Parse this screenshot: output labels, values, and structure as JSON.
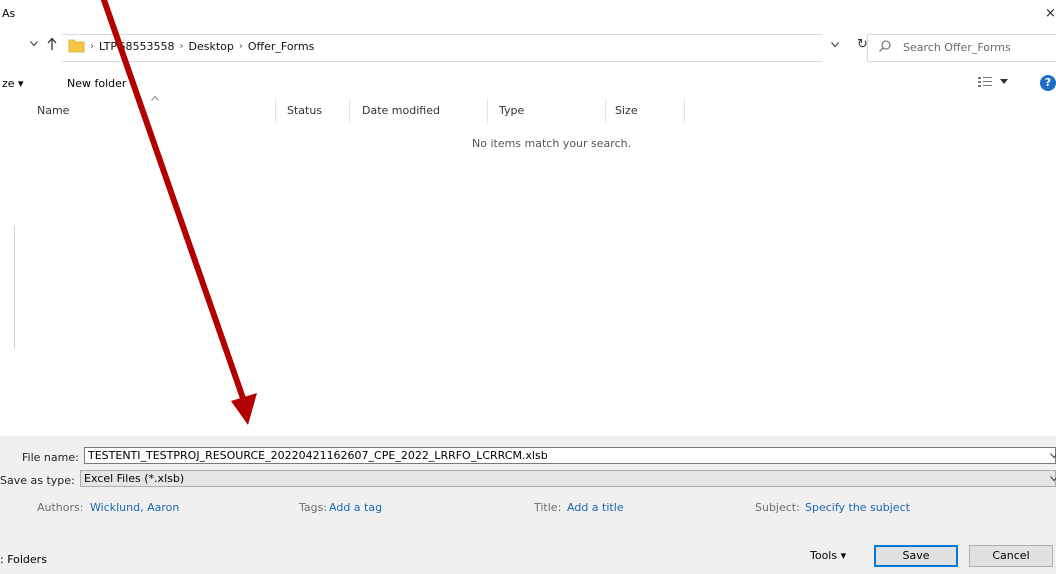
{
  "window": {
    "title": "As",
    "close_glyph": "×"
  },
  "address": {
    "crumbs": [
      "LTPG8553558",
      "Desktop",
      "Offer_Forms"
    ],
    "separator": "›",
    "search_placeholder": "Search Offer_Forms",
    "refresh_glyph": "↻"
  },
  "toolbar": {
    "organize_label": "ze ▾",
    "new_folder_label": "New folder",
    "help_label": "?"
  },
  "columns": [
    "Name",
    "Status",
    "Date modified",
    "Type",
    "Size"
  ],
  "file_list": {
    "empty_message": "No items match your search."
  },
  "form": {
    "file_name_label": "File name:",
    "file_name_value": "TESTENTI_TESTPROJ_RESOURCE_20220421162607_CPE_2022_LRRFO_LCRRCM.xlsb",
    "save_type_label": "Save as type:",
    "save_type_value": "Excel Files (*.xlsb)"
  },
  "metadata": {
    "authors_label": "Authors:",
    "authors_value": "Wicklund, Aaron",
    "tags_label": "Tags:",
    "tags_value": "Add a tag",
    "title_label": "Title:",
    "title_value": "Add a title",
    "subject_label": "Subject:",
    "subject_value": "Specify the subject"
  },
  "footer": {
    "hide_folders_label": ": Folders",
    "tools_label": "Tools ▾",
    "save_label": "Save",
    "cancel_label": "Cancel"
  },
  "colors": {
    "accent": "#0078d7",
    "link": "#1a66b3",
    "annotation_arrow": "#b30000",
    "folder": "#f4c842"
  },
  "icons": [
    "chevron-down-icon",
    "up-arrow-icon",
    "folder-icon",
    "refresh-icon",
    "search-icon",
    "view-options-icon",
    "help-icon",
    "close-icon",
    "annotation-arrow"
  ]
}
